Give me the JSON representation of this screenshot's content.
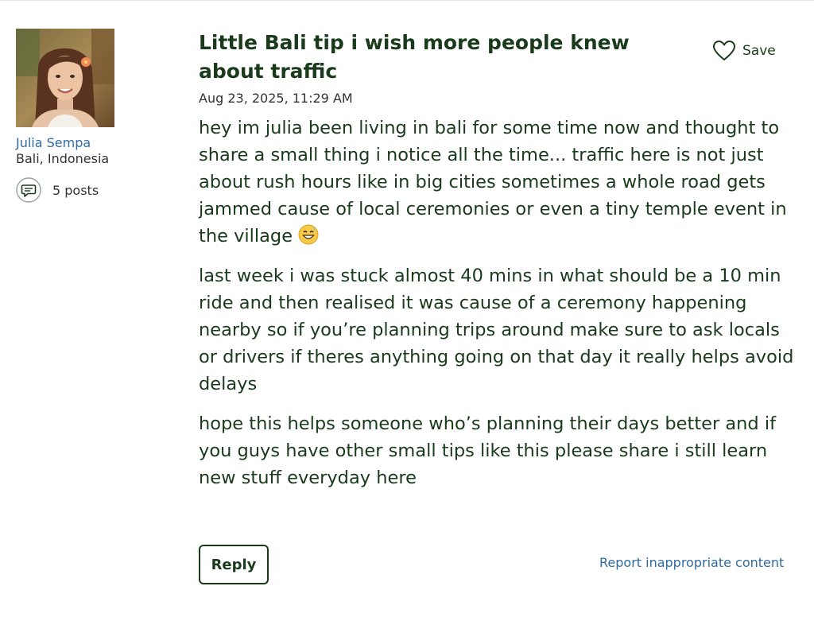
{
  "author": {
    "name": "Julia Sempa",
    "location": "Bali, Indonesia",
    "posts_label": "5 posts",
    "avatar_icon": "avatar-photo",
    "posts_icon": "speech-bubble-icon"
  },
  "post": {
    "title": "Little Bali tip i wish more people knew about traffic",
    "date": "Aug 23, 2025, 11:29 AM",
    "save_label": "Save",
    "paragraphs": [
      "hey im julia been living in bali for some time now and thought to share a small thing i notice all the time... traffic here is not just about rush hours like in big cities sometimes a whole road gets jammed cause of local ceremonies or even a tiny temple event in the village",
      "last week i was stuck almost 40 mins in what should be a 10 min ride and then realised it was cause of a ceremony happening nearby so if you’re planning trips around make sure to ask locals or drivers if theres anything going on that day it really helps avoid delays",
      "hope this helps someone who’s planning their days better and if you guys have other small tips like this please share i still learn new stuff everyday here"
    ],
    "emoji": "grinning-sweat-emoji"
  },
  "actions": {
    "reply_label": "Reply",
    "report_label": "Report inappropriate content"
  },
  "colors": {
    "text_dark_green": "#1a3a1c",
    "link_blue": "#2f6ba0"
  }
}
